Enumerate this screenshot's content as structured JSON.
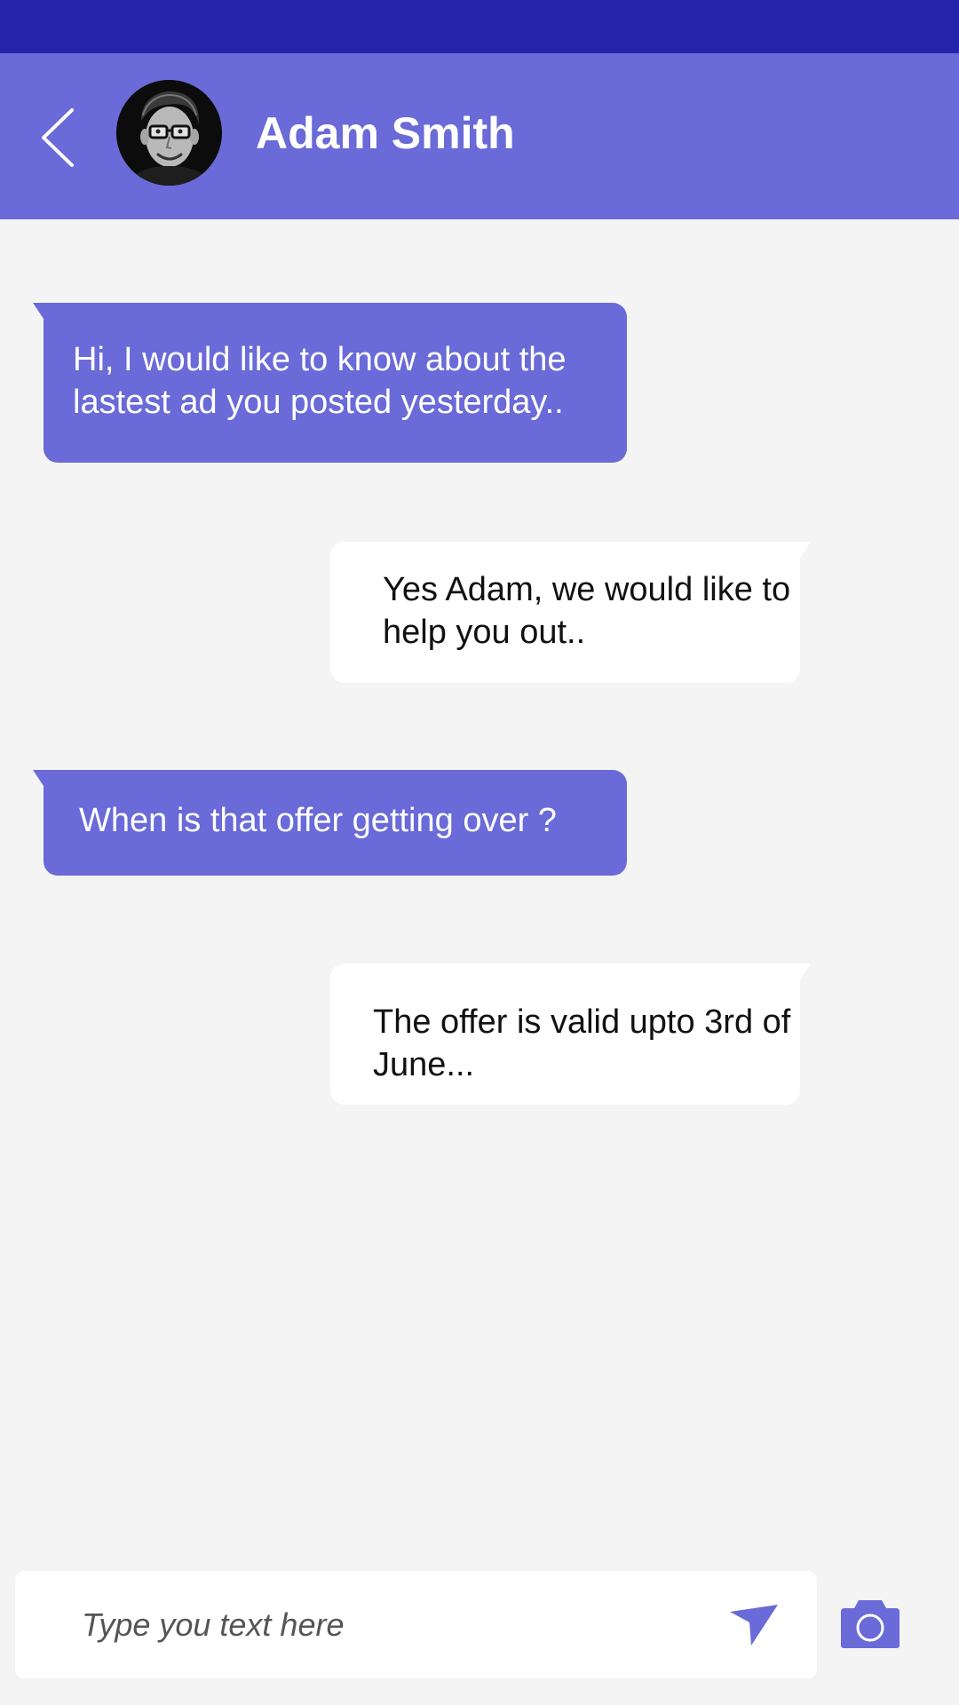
{
  "status_bar": {
    "color": "#2424ab"
  },
  "header": {
    "background": "#6a6ad8",
    "back_icon": "chevron-left-icon",
    "avatar": "contact-avatar-photo",
    "contact_name": "Adam Smith"
  },
  "messages": [
    {
      "direction": "incoming",
      "text": "Hi, I would like to know about the lastest ad you posted yesterday.."
    },
    {
      "direction": "outgoing",
      "text": "Yes Adam, we would like to help you out.."
    },
    {
      "direction": "incoming",
      "text": "When is that  offer getting over ?"
    },
    {
      "direction": "outgoing",
      "text": "The offer is valid upto 3rd of June..."
    }
  ],
  "composer": {
    "value": "",
    "placeholder": "Type you text here",
    "send_icon": "send-icon",
    "camera_icon": "camera-icon"
  },
  "colors": {
    "accent": "#6a6ad8",
    "status_bar": "#2424ab",
    "background": "#f4f4f4",
    "outgoing_bubble": "#ffffff"
  }
}
